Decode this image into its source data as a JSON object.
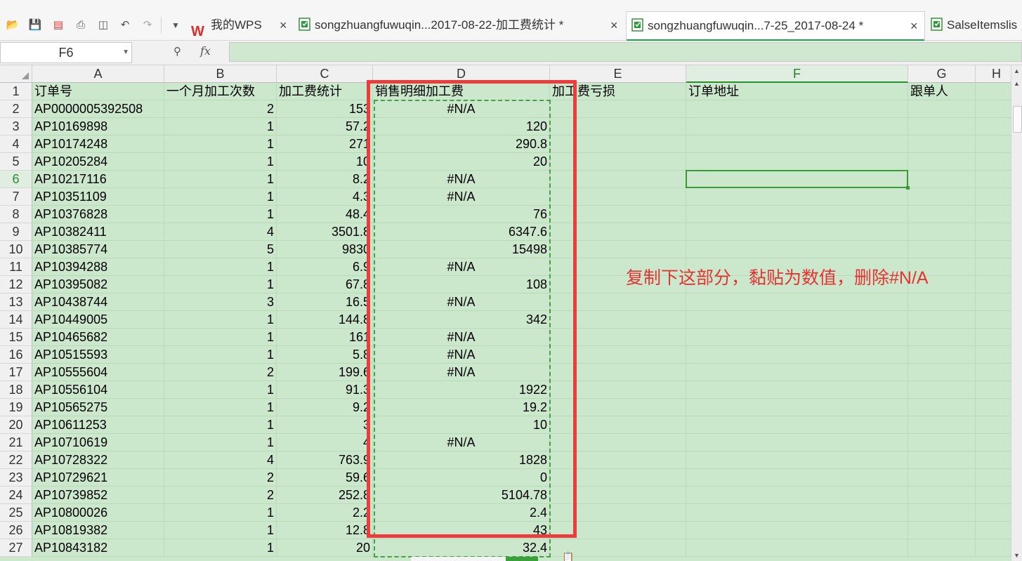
{
  "tabs": [
    {
      "label": "我的WPS",
      "icon": "wps-logo-icon"
    },
    {
      "label": "songzhuangfuwuqin...2017-08-22-加工费统计 *",
      "icon": "spreadsheet-file-icon"
    },
    {
      "label": "songzhuangfuwuqin...7-25_2017-08-24 *",
      "icon": "spreadsheet-file-icon",
      "active": true
    },
    {
      "label": "SalseItemslis",
      "icon": "spreadsheet-file-icon"
    }
  ],
  "formula_bar": {
    "cell_ref": "F6",
    "fx": "fx",
    "value": ""
  },
  "columns": [
    "A",
    "B",
    "C",
    "D",
    "E",
    "F",
    "G",
    "H"
  ],
  "selected_column": "F",
  "selected_row": 6,
  "header_row": [
    "订单号",
    "一个月加工次数",
    "加工费统计",
    "销售明细加工费",
    "加工费亏损",
    "订单地址",
    "跟单人"
  ],
  "rows": [
    [
      "AP0000005392508",
      "2",
      "153",
      "#N/A"
    ],
    [
      "AP10169898",
      "1",
      "57.2",
      "120"
    ],
    [
      "AP10174248",
      "1",
      "271",
      "290.8"
    ],
    [
      "AP10205284",
      "1",
      "10",
      "20"
    ],
    [
      "AP10217116",
      "1",
      "8.2",
      "#N/A"
    ],
    [
      "AP10351109",
      "1",
      "4.3",
      "#N/A"
    ],
    [
      "AP10376828",
      "1",
      "48.4",
      "76"
    ],
    [
      "AP10382411",
      "4",
      "3501.8",
      "6347.6"
    ],
    [
      "AP10385774",
      "5",
      "9830",
      "15498"
    ],
    [
      "AP10394288",
      "1",
      "6.9",
      "#N/A"
    ],
    [
      "AP10395082",
      "1",
      "67.8",
      "108"
    ],
    [
      "AP10438744",
      "3",
      "16.5",
      "#N/A"
    ],
    [
      "AP10449005",
      "1",
      "144.8",
      "342"
    ],
    [
      "AP10465682",
      "1",
      "161",
      "#N/A"
    ],
    [
      "AP10515593",
      "1",
      "5.8",
      "#N/A"
    ],
    [
      "AP10555604",
      "2",
      "199.6",
      "#N/A"
    ],
    [
      "AP10556104",
      "1",
      "91.3",
      "1922"
    ],
    [
      "AP10565275",
      "1",
      "9.2",
      "19.2"
    ],
    [
      "AP10611253",
      "1",
      "3",
      "10"
    ],
    [
      "AP10710619",
      "1",
      "4",
      "#N/A"
    ],
    [
      "AP10728322",
      "4",
      "763.9",
      "1828"
    ],
    [
      "AP10729621",
      "2",
      "59.6",
      "0"
    ],
    [
      "AP10739852",
      "2",
      "252.8",
      "5104.78"
    ],
    [
      "AP10800026",
      "1",
      "2.2",
      "2.4"
    ],
    [
      "AP10819382",
      "1",
      "12.8",
      "43"
    ],
    [
      "AP10843182",
      "1",
      "20",
      "32.4"
    ]
  ],
  "annotation": "复制下这部分，黏贴为数值，删除#N/A",
  "colors": {
    "sheet_bg": "#cce8cc",
    "highlight_red": "#ee3b3b",
    "selection_green": "#3a9a3a"
  }
}
